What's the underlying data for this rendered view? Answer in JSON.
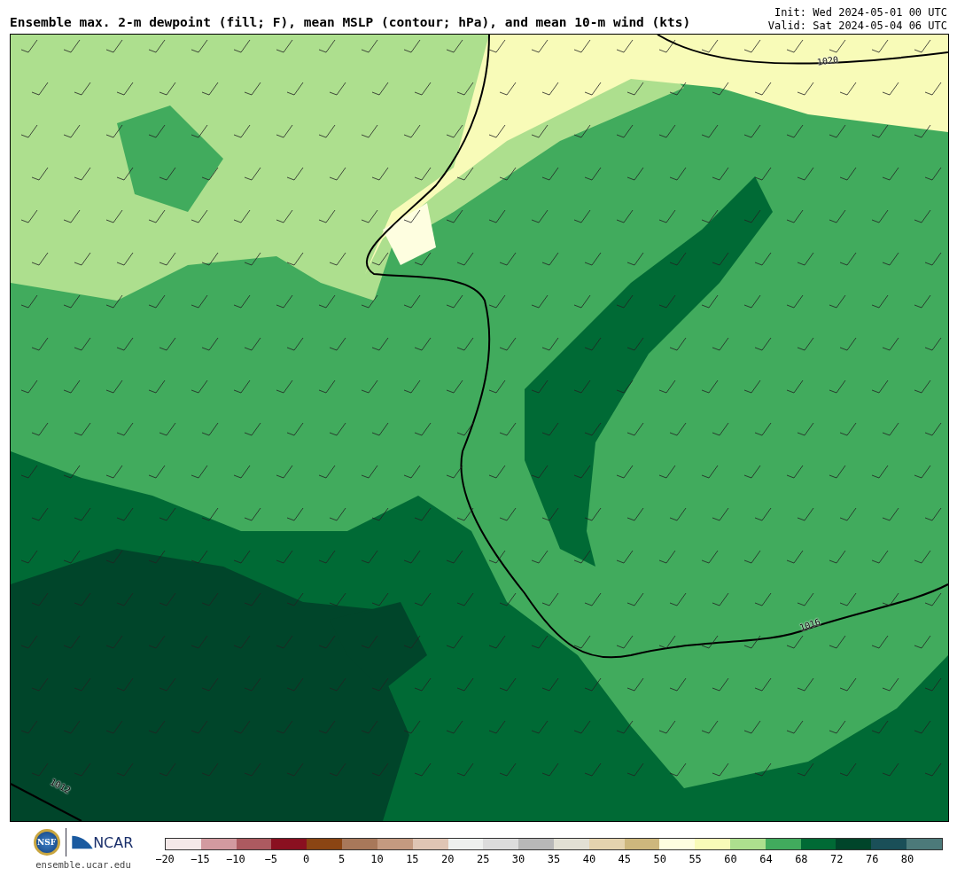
{
  "title": "Ensemble max. 2-m dewpoint (fill; F), mean MSLP (contour; hPa), and mean 10-m wind (kts)",
  "init": "Init: Wed 2024-05-01 00 UTC",
  "valid": "Valid: Sat 2024-05-04 06 UTC",
  "map": {
    "contours": [
      {
        "label": "1020"
      },
      {
        "label": "1016"
      },
      {
        "label": "1012"
      }
    ]
  },
  "logos": {
    "nsf": "NSF",
    "ncar": "NCAR",
    "site": "ensemble.ucar.edu"
  },
  "colorbar": {
    "segments": [
      {
        "color": "#f4e8e8"
      },
      {
        "color": "#d29aa0"
      },
      {
        "color": "#ac5a60"
      },
      {
        "color": "#8a1020"
      },
      {
        "color": "#8b4513"
      },
      {
        "color": "#a8785a"
      },
      {
        "color": "#c49a80"
      },
      {
        "color": "#dfc5b4"
      },
      {
        "color": "#eef0ee"
      },
      {
        "color": "#dcdcdc"
      },
      {
        "color": "#b8b8b8"
      },
      {
        "color": "#e2e0d4"
      },
      {
        "color": "#e4d3ae"
      },
      {
        "color": "#cdb77d"
      },
      {
        "color": "#fefee0"
      },
      {
        "color": "#f8fbb8"
      },
      {
        "color": "#addf8e"
      },
      {
        "color": "#41ab5d"
      },
      {
        "color": "#006a35"
      },
      {
        "color": "#00452a"
      },
      {
        "color": "#1a4f58"
      },
      {
        "color": "#4c7a7a"
      }
    ],
    "ticks": [
      "−20",
      "−15",
      "−10",
      "−5",
      "0",
      "5",
      "10",
      "15",
      "20",
      "25",
      "30",
      "35",
      "40",
      "45",
      "50",
      "55",
      "60",
      "64",
      "68",
      "72",
      "76",
      "80"
    ]
  }
}
